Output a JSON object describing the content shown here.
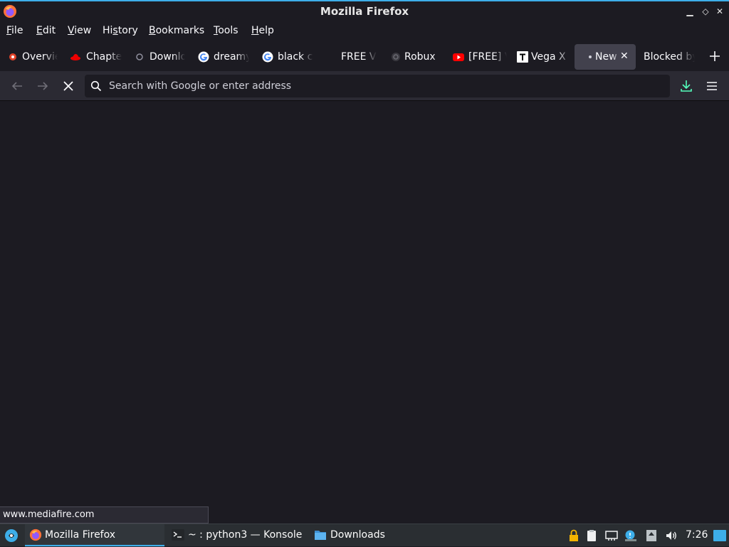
{
  "window": {
    "title": "Mozilla Firefox"
  },
  "menubar": {
    "items": [
      {
        "mnemonic": "F",
        "rest": "ile"
      },
      {
        "mnemonic": "E",
        "rest": "dit"
      },
      {
        "mnemonic": "V",
        "rest": "iew"
      },
      {
        "pre": "Hi",
        "mnemonic": "s",
        "rest": "tory"
      },
      {
        "mnemonic": "B",
        "rest": "ookmarks"
      },
      {
        "mnemonic": "T",
        "rest": "ools"
      },
      {
        "mnemonic": "H",
        "rest": "elp"
      }
    ]
  },
  "tabs": [
    {
      "label": "Overview",
      "icon": "gitlab-icon"
    },
    {
      "label": "Chapter",
      "icon": "redhat-icon"
    },
    {
      "label": "Download",
      "icon": "download-site-icon"
    },
    {
      "label": "dreamy",
      "icon": "google-icon"
    },
    {
      "label": "black c",
      "icon": "google-icon"
    },
    {
      "label": "FREE V-",
      "icon": "none"
    },
    {
      "label": "Robux",
      "icon": "robux-icon"
    },
    {
      "label": "[FREE] V",
      "icon": "youtube-icon"
    },
    {
      "label": "Vega X",
      "icon": "t-icon"
    },
    {
      "label": "New",
      "icon": "loading-dot-icon",
      "active": true
    },
    {
      "label": "Blocked by",
      "icon": "none"
    }
  ],
  "navbar": {
    "url_placeholder": "Search with Google or enter address",
    "url_value": ""
  },
  "status": {
    "link": "www.mediafire.com"
  },
  "taskbar": {
    "tasks": [
      {
        "label": "Mozilla Firefox",
        "icon": "firefox-icon",
        "active": true
      },
      {
        "label": "~ : python3 — Konsole",
        "icon": "konsole-icon"
      },
      {
        "label": "Downloads",
        "icon": "folder-icon"
      }
    ],
    "clock": "7:26"
  },
  "colors": {
    "accent": "#3daee9",
    "background": "#1c1b22",
    "toolbar": "#2b2a33",
    "download_icon": "#54ffbd"
  }
}
